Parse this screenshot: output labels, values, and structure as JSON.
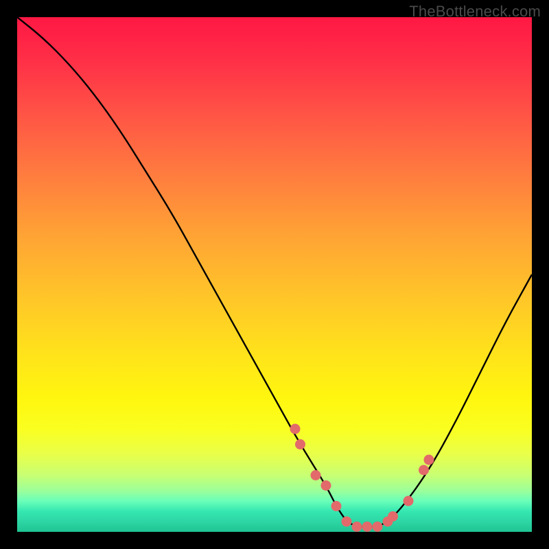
{
  "watermark": "TheBottleneck.com",
  "colors": {
    "background": "#000000",
    "curve": "#000000",
    "dots": "#e26a6a",
    "gradient_top": "#ff1844",
    "gradient_bottom": "#1fc593"
  },
  "chart_data": {
    "type": "line",
    "title": "",
    "xlabel": "",
    "ylabel": "",
    "xlim": [
      0,
      100
    ],
    "ylim": [
      0,
      100
    ],
    "series": [
      {
        "name": "bottleneck-curve",
        "x": [
          0,
          5,
          10,
          15,
          20,
          25,
          30,
          35,
          40,
          45,
          50,
          55,
          60,
          62,
          64,
          66,
          68,
          70,
          72,
          75,
          80,
          85,
          90,
          95,
          100
        ],
        "values": [
          100,
          96,
          91,
          85,
          78,
          70,
          62,
          53,
          44,
          35,
          26,
          17,
          9,
          5,
          2,
          1,
          1,
          1,
          2,
          5,
          12,
          21,
          31,
          41,
          50
        ]
      }
    ],
    "markers": {
      "name": "highlighted-region-dots",
      "x": [
        54,
        55,
        58,
        60,
        62,
        64,
        66,
        68,
        70,
        72,
        73,
        76,
        79,
        80
      ],
      "values": [
        20,
        17,
        11,
        9,
        5,
        2,
        1,
        1,
        1,
        2,
        3,
        6,
        12,
        14
      ]
    }
  }
}
